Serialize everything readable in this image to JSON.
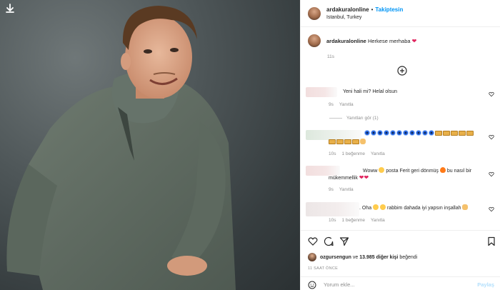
{
  "post": {
    "username": "ardakuralonline",
    "separator": "•",
    "follow_label": "Takiptesin",
    "location": "Istanbul, Turkey",
    "caption_user": "ardakuralonline",
    "caption_text": "Herkese merhaba",
    "caption_time": "11s"
  },
  "comments": [
    {
      "text": "Yeni hali mi? Helal olsun",
      "time": "9s",
      "reply_label": "Yanıtla"
    },
    {
      "time": "10s",
      "likes": "1 beğenme",
      "reply_label": "Yanıtla"
    },
    {
      "text_part1": "Woww",
      "text_part2": "posta Ferit geri dönmüş",
      "text_part3": "bu nasıl bir",
      "text_line2": "mükemmellik",
      "time": "9s",
      "reply_label": "Yanıtla"
    },
    {
      "text_part1": ". Oha",
      "text_part2": "rabbim dahada iyi yapsın inşallah",
      "time": "10s",
      "likes": "1 beğenme",
      "reply_label": "Yanıtla"
    }
  ],
  "view_replies": "Yanıtları gör (1)",
  "likes": {
    "user": "ozgursengun",
    "connector": "ve",
    "count_text": "13.985 diğer kişi",
    "suffix": "beğendi"
  },
  "time_ago": "11 SAAT ÖNCE",
  "add_comment": {
    "placeholder": "Yorum ekle...",
    "post_label": "Paylaş"
  },
  "colors": {
    "accent": "#0095f6",
    "muted": "#8e8e8e",
    "heart": "#ed4956",
    "post_disabled": "#b2dffc"
  }
}
